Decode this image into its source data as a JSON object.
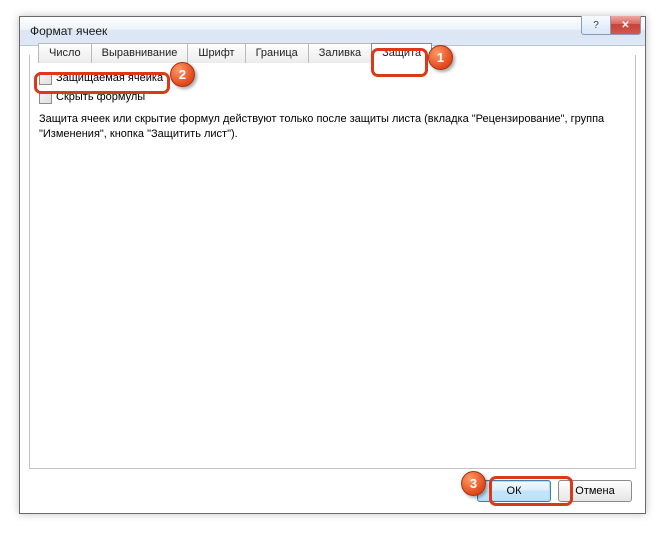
{
  "window": {
    "title": "Формат ячеек"
  },
  "controls": {
    "help_glyph": "?",
    "close_glyph": "✕"
  },
  "tabs": [
    {
      "label": "Число"
    },
    {
      "label": "Выравнивание"
    },
    {
      "label": "Шрифт"
    },
    {
      "label": "Граница"
    },
    {
      "label": "Заливка"
    },
    {
      "label": "Защита",
      "active": true
    }
  ],
  "protect": {
    "locked_label": "Защищаемая ячейка",
    "hidden_label": "Скрыть формулы",
    "description": "Защита ячеек или скрытие формул действуют только после защиты листа (вкладка \"Рецензирование\", группа \"Изменения\", кнопка \"Защитить лист\")."
  },
  "buttons": {
    "ok": "ОК",
    "cancel": "Отмена"
  },
  "markers": {
    "m1": "1",
    "m2": "2",
    "m3": "3"
  }
}
